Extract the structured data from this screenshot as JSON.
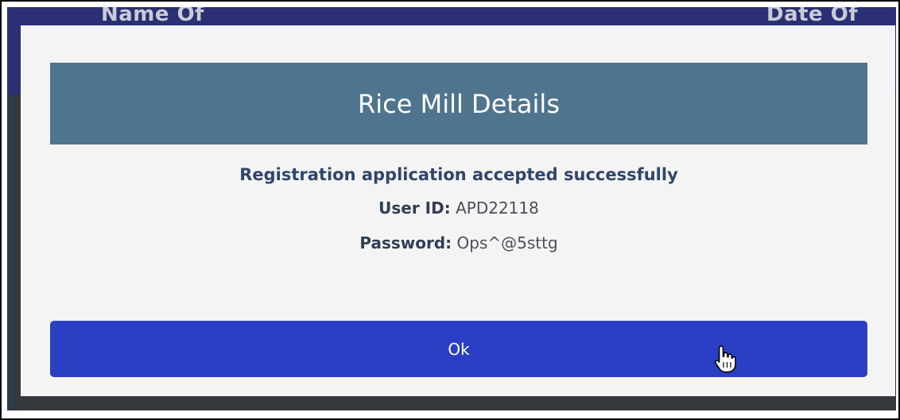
{
  "background": {
    "column_left": "Name Of",
    "column_right": "Date Of"
  },
  "dialog": {
    "title": "Rice Mill Details",
    "message": "Registration application accepted successfully",
    "user_id_label": "User ID:",
    "user_id_value": "APD22118",
    "password_label": "Password:",
    "password_value": "Ops^@5sttg",
    "ok_label": "Ok"
  },
  "colors": {
    "header_bg": "#4f748e",
    "button_bg": "#2b3fc4",
    "message_text": "#2f4669"
  },
  "icons": {
    "cursor": "hand-pointer-icon"
  }
}
